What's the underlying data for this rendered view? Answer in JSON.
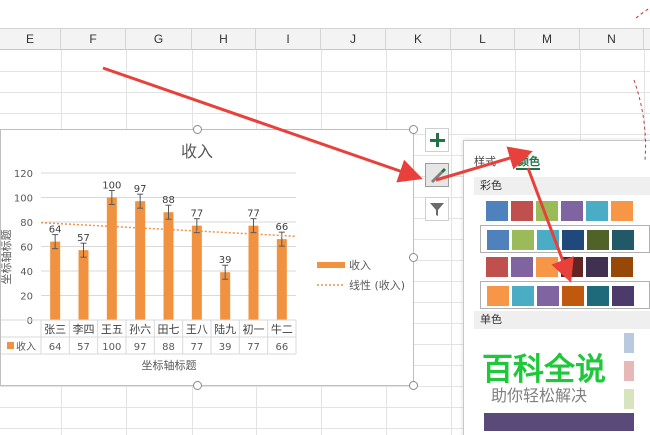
{
  "columns": [
    "E",
    "F",
    "G",
    "H",
    "I",
    "J",
    "K",
    "L",
    "M",
    "N"
  ],
  "chart": {
    "title": "收入",
    "y_axis_title": "坐标轴标题",
    "x_axis_title": "坐标轴标题",
    "legend": {
      "bars": "收入",
      "trend": "线性 (收入)"
    },
    "table_row_label": "收入"
  },
  "chart_data": {
    "type": "bar",
    "title": "收入",
    "xlabel": "坐标轴标题",
    "ylabel": "坐标轴标题",
    "categories": [
      "张三",
      "李四",
      "王五",
      "孙六",
      "田七",
      "王八",
      "陆九",
      "初一",
      "牛二"
    ],
    "series": [
      {
        "name": "收入",
        "values": [
          64,
          57,
          100,
          97,
          88,
          77,
          39,
          77,
          66
        ]
      }
    ],
    "trendline": {
      "name": "线性 (收入)",
      "type": "linear"
    },
    "error_bars": true,
    "ylim": [
      0,
      120
    ],
    "yticks": [
      0,
      20,
      40,
      60,
      80,
      100,
      120
    ],
    "grid": true,
    "legend_position": "right",
    "data_table": true,
    "colors": {
      "bar": "#f0923f",
      "trend": "#f0923f"
    }
  },
  "side_buttons": [
    {
      "name": "chart-elements-button",
      "icon": "plus-icon"
    },
    {
      "name": "chart-styles-button",
      "icon": "brush-icon"
    },
    {
      "name": "chart-filters-button",
      "icon": "filter-icon"
    }
  ],
  "panel": {
    "tabs": [
      "样式",
      "颜色"
    ],
    "active_tab": "颜色",
    "sections": [
      "彩色",
      "单色"
    ],
    "colorful_rows": [
      [
        "#4f81bd",
        "#c0504d",
        "#9bbb59",
        "#8064a2",
        "#4bacc6",
        "#f79646"
      ],
      [
        "#4f81bd",
        "#9bbb59",
        "#4bacc6",
        "#1f497d",
        "#4f6228",
        "#215968"
      ],
      [
        "#c0504d",
        "#8064a2",
        "#f79646",
        "#632423",
        "#403151",
        "#974806"
      ],
      [
        "#f79646",
        "#4bacc6",
        "#8064a2",
        "#c0590e",
        "#1f6a7a",
        "#4c3a6b"
      ]
    ],
    "monochrome_colors": [
      "#b9c9e0",
      "#e8b8b6",
      "#d7e4bd",
      "#5a4a7a"
    ]
  },
  "watermark": {
    "title": "百科全说",
    "subtitle": "助你轻松解决"
  },
  "colors": {
    "accent_green": "#217346",
    "arrow_red": "#e8403a",
    "bar_orange": "#f0923f"
  }
}
